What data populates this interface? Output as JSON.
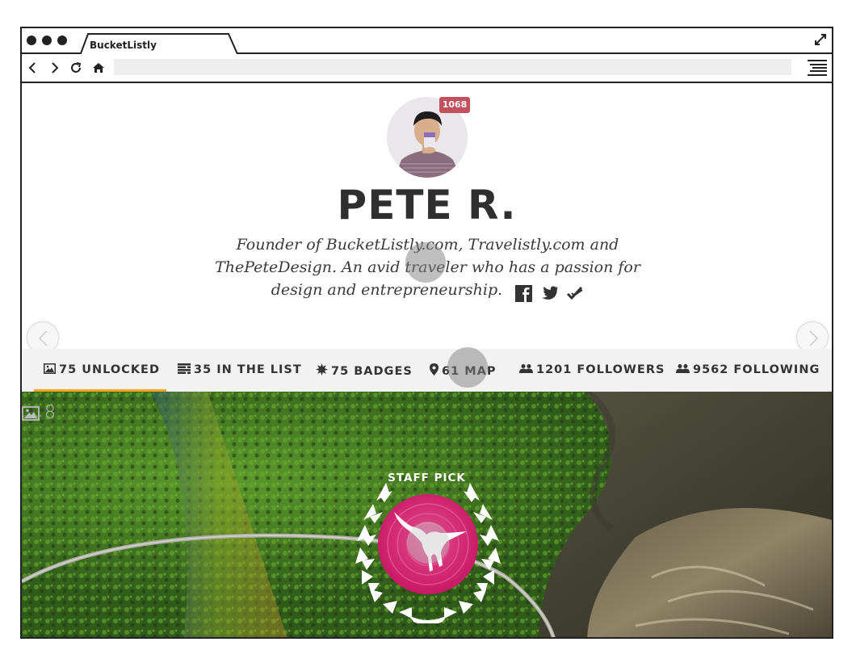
{
  "window": {
    "tab_title": "BucketListly"
  },
  "profile": {
    "notification_count": "1068",
    "name": "PETE R.",
    "bio": "Founder of BucketListly.com, Travelistly.com and ThePeteDesign. An avid traveler who has a passion for design and entrepreneurship."
  },
  "stats": [
    {
      "label": "75 UNLOCKED",
      "icon": "image-icon"
    },
    {
      "label": "35 IN THE LIST",
      "icon": "list-icon"
    },
    {
      "label": "75 BADGES",
      "icon": "badge-icon"
    },
    {
      "label": "61 MAP",
      "icon": "map-pin-icon"
    },
    {
      "label": "1201 FOLLOWERS",
      "icon": "users-icon"
    },
    {
      "label": "9562 FOLLOWING",
      "icon": "users-icon"
    }
  ],
  "hero": {
    "photo_count": "8",
    "staff_pick": "STAFF PICK"
  },
  "colors": {
    "badge": "#c4505e",
    "active_tab": "#f5a623",
    "staff_pick": "#d8256e"
  }
}
